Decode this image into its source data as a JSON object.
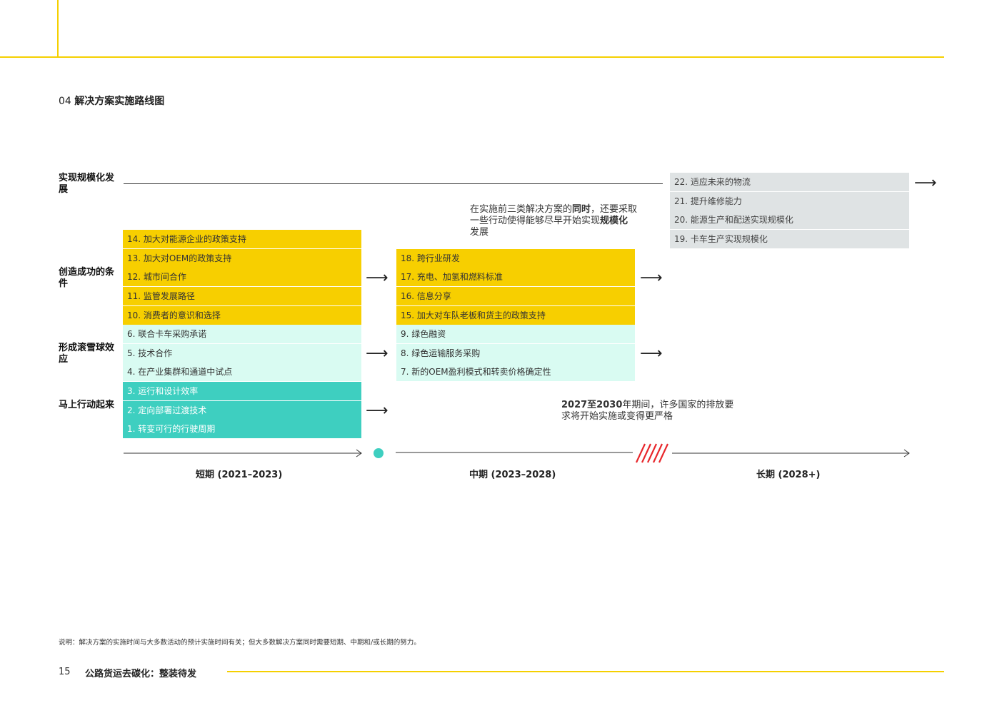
{
  "section": {
    "num": "04",
    "title": "解决方案实施路线图"
  },
  "rows": {
    "scale": "实现规模化发展",
    "conditions": "创造成功的条件",
    "snowball": "形成滚雪球效应",
    "act_now": "马上行动起来"
  },
  "long_items": [
    "22. 适应未来的物流",
    "21. 提升维修能力",
    "20. 能源生产和配送实现规模化",
    "19. 卡车生产实现规模化"
  ],
  "short_yellow": [
    "14. 加大对能源企业的政策支持",
    "13. 加大对OEM的政策支持",
    "12. 城市间合作",
    "11. 监管发展路径",
    "10. 消费者的意识和选择"
  ],
  "short_mint": [
    "6. 联合卡车采购承诺",
    "5. 技术合作",
    "4. 在产业集群和通道中试点"
  ],
  "short_teal": [
    "3. 运行和设计效率",
    "2. 定向部署过渡技术",
    "1. 转变可行的行驶周期"
  ],
  "mid_yellow": [
    "18. 跨行业研发",
    "17. 充电、加氢和燃料标准",
    "16. 信息分享",
    "15. 加大对车队老板和货主的政策支持"
  ],
  "mid_mint": [
    "9. 绿色融资",
    "8. 绿色运输服务采购",
    "7. 新的OEM盈利模式和转卖价格确定性"
  ],
  "note_mid": {
    "a": "在实施前三类解决方案的",
    "b": "同时",
    "c": "，还要采取",
    "d": "一些行动使得能够尽早开始实现",
    "e": "规模化",
    "f": "发展"
  },
  "note_2027": {
    "a": "2027至2030",
    "b": "年期间，许多国家的排放要",
    "c": "求将开始实施或变得更严格"
  },
  "periods": {
    "short": "短期 (2021–2023)",
    "mid": "中期 (2023–2028)",
    "long": "长期 (2028+)"
  },
  "colors": {
    "yellow": "#f7cf00",
    "mint": "#d9fbf2",
    "teal": "#3ecfc0",
    "gray": "#dfe3e4",
    "red": "#e8262b"
  },
  "footnote": "说明：解决方案的实施时间与大多数活动的预计实施时间有关；但大多数解决方案同时需要短期、中期和/或长期的努力。",
  "footer": {
    "page": "15",
    "title": "公路货运去碳化：整装待发"
  }
}
